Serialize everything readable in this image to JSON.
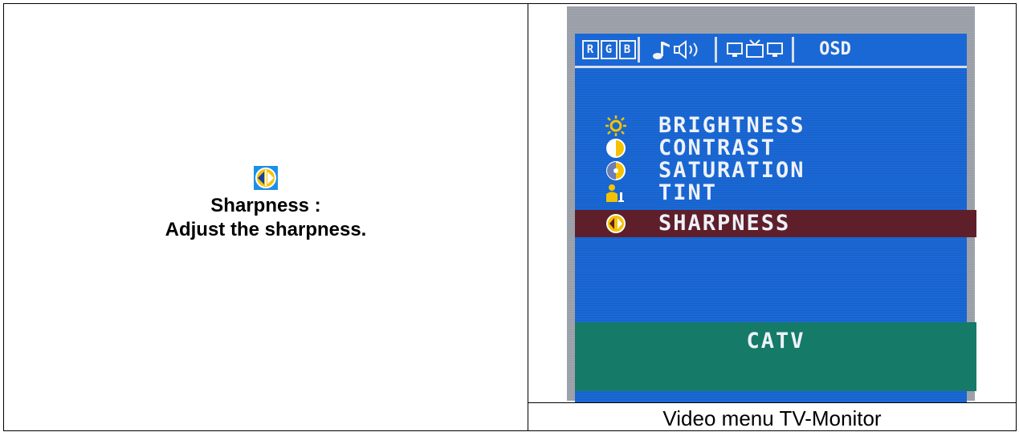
{
  "description": {
    "icon": "sharpness-icon",
    "title": "Sharpness :",
    "body": "Adjust the sharpness."
  },
  "caption": "Video menu TV-Monitor",
  "osd": {
    "tabs": [
      {
        "name": "rgb-tab",
        "letters": [
          "R",
          "G",
          "B"
        ]
      },
      {
        "name": "audio-tab",
        "icon": "music-speaker-icon"
      },
      {
        "name": "video-tab",
        "icon": "monitor-tv-icon"
      },
      {
        "name": "osd-tab",
        "label": "OSD"
      }
    ],
    "items": [
      {
        "icon": "sun-icon",
        "label": "BRIGHTNESS",
        "selected": false
      },
      {
        "icon": "half-circle-icon",
        "label": "CONTRAST",
        "selected": false
      },
      {
        "icon": "saturation-icon",
        "label": "SATURATION",
        "selected": false
      },
      {
        "icon": "person-tint-icon",
        "label": "TINT",
        "selected": false
      },
      {
        "icon": "sharpness-icon",
        "label": "SHARPNESS",
        "selected": true
      }
    ],
    "footer": "CATV",
    "colors": {
      "background": "#1a68d6",
      "selected": "#5e1f2a",
      "footer": "#157a68"
    }
  }
}
